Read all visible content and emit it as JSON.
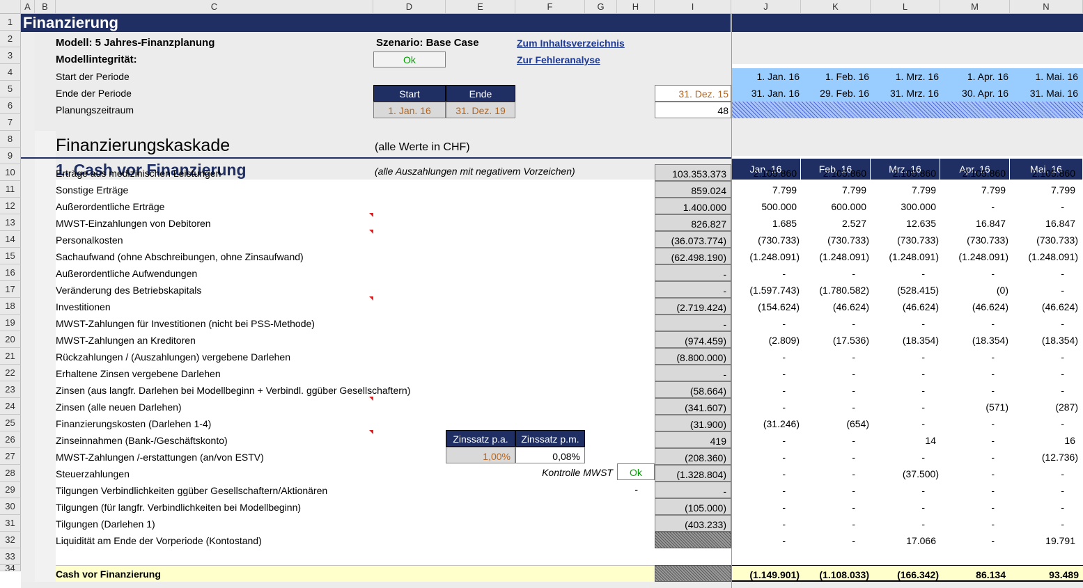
{
  "column_headers": [
    "A",
    "B",
    "C",
    "D",
    "E",
    "F",
    "G",
    "H",
    "I",
    "J",
    "K",
    "L",
    "M",
    "N"
  ],
  "row_numbers": [
    "1",
    "2",
    "3",
    "4",
    "5",
    "6",
    "7",
    "8",
    "9",
    "10",
    "11",
    "12",
    "13",
    "14",
    "15",
    "16",
    "17",
    "18",
    "19",
    "20",
    "21",
    "22",
    "23",
    "24",
    "25",
    "26",
    "27",
    "28",
    "29",
    "30",
    "31",
    "32",
    "33",
    "34"
  ],
  "header": {
    "title": "Finanzierung",
    "model_label": "Modell: 5 Jahres-Finanzplanung",
    "integrity_label": "Modellintegrität:",
    "integrity_value": "Ok",
    "scenario": "Szenario: Base Case",
    "link_toc": "Zum Inhaltsverzeichnis",
    "link_errors": "Zur Fehleranalyse"
  },
  "period": {
    "start_label": "Start der Periode",
    "end_label": "Ende der Periode",
    "plan_label": "Planungszeitraum",
    "start_header": "Start",
    "end_header": "Ende",
    "start_value": "1. Jan. 16",
    "end_value": "31. Dez. 19",
    "i_end": "31. Dez. 15",
    "i_plan": "48",
    "starts": [
      "1. Jan. 16",
      "1. Feb. 16",
      "1. Mrz. 16",
      "1. Apr. 16",
      "1. Mai. 16"
    ],
    "ends": [
      "31. Jan. 16",
      "29. Feb. 16",
      "31. Mrz. 16",
      "30. Apr. 16",
      "31. Mai. 16"
    ]
  },
  "section": {
    "heading": "Finanzierungskaskade",
    "unit_note": "(alle Werte in CHF)",
    "sub_heading": "1. Cash vor Finanzierung",
    "sign_note": "(alle Auszahlungen mit negativem Vorzeichen)",
    "months": [
      "Jan. 16",
      "Feb. 16",
      "Mrz. 16",
      "Apr. 16",
      "Mai. 16"
    ]
  },
  "rate": {
    "pa_label": "Zinssatz p.a.",
    "pm_label": "Zinssatz p.m.",
    "pa_value": "1,00%",
    "pm_value": "0,08%"
  },
  "vat_check": {
    "label": "Kontrolle MWST",
    "value": "Ok"
  },
  "h28": "-",
  "rows": [
    {
      "label": "Erträge aus medizinischen Leistungen",
      "total": "103.353.373",
      "months": [
        "2.105.860",
        "2.105.860",
        "2.105.860",
        "2.105.860",
        "2.105.860"
      ]
    },
    {
      "label": "Sonstige Erträge",
      "total": "859.024",
      "months": [
        "7.799",
        "7.799",
        "7.799",
        "7.799",
        "7.799"
      ]
    },
    {
      "label": "Außerordentliche Erträge",
      "total": "1.400.000",
      "months": [
        "500.000",
        "600.000",
        "300.000",
        "-",
        "-"
      ]
    },
    {
      "label": "MWST-Einzahlungen von Debitoren",
      "total": "826.827",
      "months": [
        "1.685",
        "2.527",
        "12.635",
        "16.847",
        "16.847"
      ]
    },
    {
      "label": "Personalkosten",
      "total": "(36.073.774)",
      "months": [
        "(730.733)",
        "(730.733)",
        "(730.733)",
        "(730.733)",
        "(730.733)"
      ]
    },
    {
      "label": "Sachaufwand (ohne Abschreibungen, ohne Zinsaufwand)",
      "total": "(62.498.190)",
      "months": [
        "(1.248.091)",
        "(1.248.091)",
        "(1.248.091)",
        "(1.248.091)",
        "(1.248.091)"
      ]
    },
    {
      "label": "Außerordentliche Aufwendungen",
      "total": "-",
      "months": [
        "-",
        "-",
        "-",
        "-",
        "-"
      ]
    },
    {
      "label": "Veränderung des Betriebskapitals",
      "total": "-",
      "months": [
        "(1.597.743)",
        "(1.780.582)",
        "(528.415)",
        "(0)",
        "-"
      ]
    },
    {
      "label": "Investitionen",
      "total": "(2.719.424)",
      "months": [
        "(154.624)",
        "(46.624)",
        "(46.624)",
        "(46.624)",
        "(46.624)"
      ]
    },
    {
      "label": "MWST-Zahlungen für Investitionen (nicht bei PSS-Methode)",
      "total": "-",
      "months": [
        "-",
        "-",
        "-",
        "-",
        "-"
      ]
    },
    {
      "label": "MWST-Zahlungen an Kreditoren",
      "total": "(974.459)",
      "months": [
        "(2.809)",
        "(17.536)",
        "(18.354)",
        "(18.354)",
        "(18.354)"
      ]
    },
    {
      "label": "Rückzahlungen / (Auszahlungen) vergebene Darlehen",
      "total": "(8.800.000)",
      "months": [
        "-",
        "-",
        "-",
        "-",
        "-"
      ]
    },
    {
      "label": "Erhaltene Zinsen vergebene Darlehen",
      "total": "-",
      "months": [
        "-",
        "-",
        "-",
        "-",
        "-"
      ]
    },
    {
      "label": "Zinsen (aus langfr. Darlehen bei Modellbeginn + Verbindl. ggüber Gesellschaftern)",
      "total": "(58.664)",
      "months": [
        "-",
        "-",
        "-",
        "-",
        "-"
      ]
    },
    {
      "label": "Zinsen (alle neuen Darlehen)",
      "total": "(341.607)",
      "months": [
        "-",
        "-",
        "-",
        "(571)",
        "(287)"
      ]
    },
    {
      "label": "Finanzierungskosten (Darlehen 1-4)",
      "total": "(31.900)",
      "months": [
        "(31.246)",
        "(654)",
        "-",
        "-",
        "-"
      ]
    },
    {
      "label": "Zinseinnahmen (Bank-/Geschäftskonto)",
      "total": "419",
      "months": [
        "-",
        "-",
        "14",
        "-",
        "16"
      ]
    },
    {
      "label": "MWST-Zahlungen /-erstattungen (an/von ESTV)",
      "total": "(208.360)",
      "months": [
        "-",
        "-",
        "-",
        "-",
        "(12.736)"
      ]
    },
    {
      "label": "Steuerzahlungen",
      "total": "(1.328.804)",
      "months": [
        "-",
        "-",
        "(37.500)",
        "-",
        "-"
      ]
    },
    {
      "label": "Tilgungen Verbindlichkeiten ggüber Gesellschaftern/Aktionären",
      "total": "-",
      "months": [
        "-",
        "-",
        "-",
        "-",
        "-"
      ]
    },
    {
      "label": "Tilgungen (für langfr. Verbindlichkeiten bei Modellbeginn)",
      "total": "(105.000)",
      "months": [
        "-",
        "-",
        "-",
        "-",
        "-"
      ]
    },
    {
      "label": "Tilgungen (Darlehen 1)",
      "total": "(403.233)",
      "months": [
        "-",
        "-",
        "-",
        "-",
        "-"
      ]
    },
    {
      "label": "Liquidität am Ende der Vorperiode (Kontostand)",
      "total": "",
      "months": [
        "-",
        "-",
        "17.066",
        "-",
        "19.791"
      ]
    }
  ],
  "total_row": {
    "label": "Cash vor Finanzierung",
    "months": [
      "(1.149.901)",
      "(1.108.033)",
      "(166.342)",
      "86.134",
      "93.489"
    ]
  },
  "colors": {
    "navy": "#1f2f63",
    "light_blue": "#99ccff",
    "yellow": "#ffffcc",
    "gray": "#d9d9d9"
  }
}
